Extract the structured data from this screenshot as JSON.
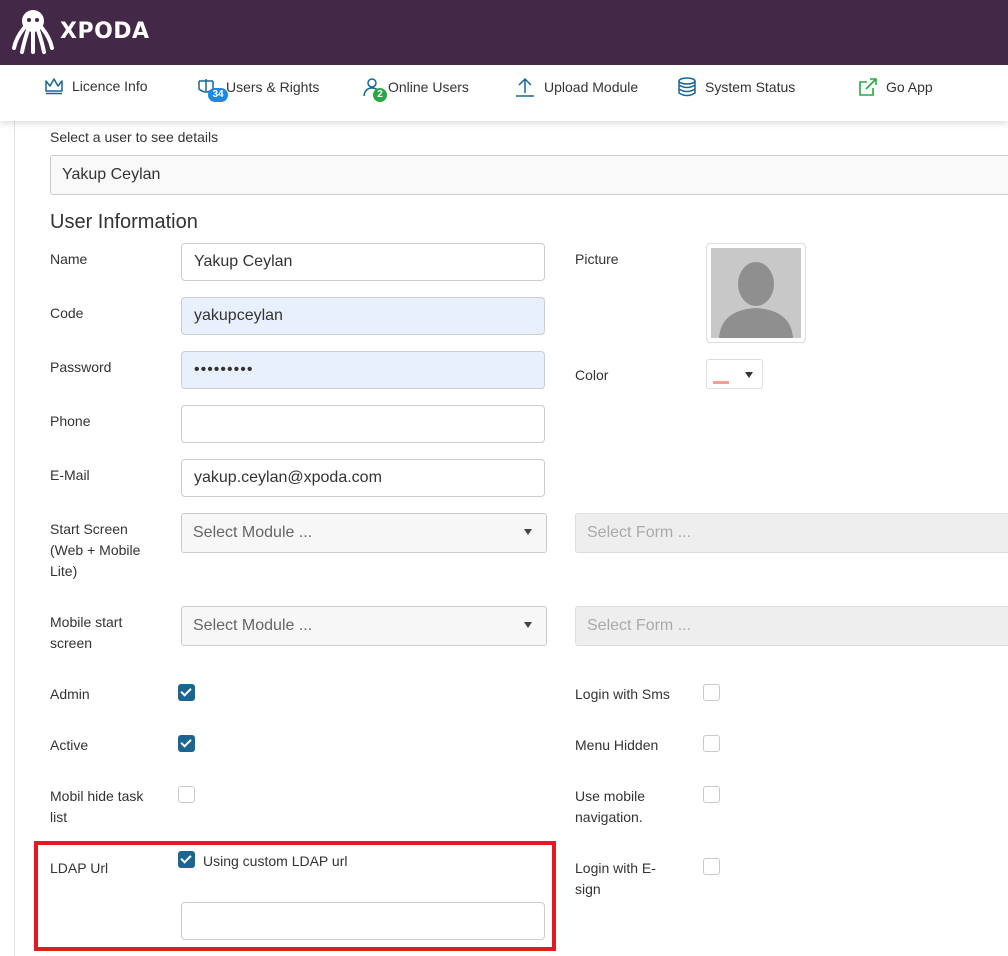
{
  "brand": {
    "name": "XPODA"
  },
  "nav": {
    "items": [
      {
        "label": "Licence Info",
        "icon": "crown-icon"
      },
      {
        "label": "Users & Rights",
        "icon": "users-rights-icon",
        "badge": "34"
      },
      {
        "label": "Online Users",
        "icon": "user-online-icon",
        "badge": "2"
      },
      {
        "label": "Upload Module",
        "icon": "upload-icon"
      },
      {
        "label": "System Status",
        "icon": "database-icon"
      },
      {
        "label": "Go App",
        "icon": "external-link-icon"
      }
    ]
  },
  "colors": {
    "header": "#432847",
    "accent": "#1a6690",
    "highlight": "#e01b24"
  },
  "user_select": {
    "label": "Select a user to see details",
    "value": "Yakup Ceylan"
  },
  "section_title": "User Information",
  "form": {
    "name": {
      "label": "Name",
      "value": "Yakup Ceylan"
    },
    "code": {
      "label": "Code",
      "value": "yakupceylan"
    },
    "password": {
      "label": "Password",
      "value": "•••••••••"
    },
    "phone": {
      "label": "Phone",
      "value": ""
    },
    "email": {
      "label": "E-Mail",
      "value": "yakup.ceylan@xpoda.com"
    },
    "picture": {
      "label": "Picture"
    },
    "color": {
      "label": "Color"
    },
    "start_screen": {
      "label": "Start Screen (Web + Mobile Lite)",
      "module_placeholder": "Select Module ...",
      "form_placeholder": "Select Form ..."
    },
    "mobile_start": {
      "label": "Mobile start screen",
      "module_placeholder": "Select Module ...",
      "form_placeholder": "Select Form ..."
    },
    "admin": {
      "label": "Admin",
      "checked": true
    },
    "active": {
      "label": "Active",
      "checked": true
    },
    "mobil_hide": {
      "label": "Mobil hide task list",
      "checked": false
    },
    "ldap": {
      "label": "LDAP Url",
      "checkbox_label": "Using custom LDAP url",
      "checked": true,
      "value": ""
    },
    "login_sms": {
      "label": "Login with Sms",
      "checked": false
    },
    "menu_hidden": {
      "label": "Menu Hidden",
      "checked": false
    },
    "mobile_nav": {
      "label": "Use mobile navigation.",
      "checked": false
    },
    "login_esign": {
      "label": "Login with E-sign",
      "checked": false
    }
  }
}
